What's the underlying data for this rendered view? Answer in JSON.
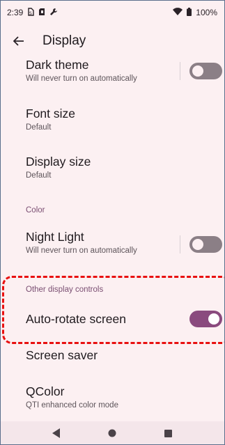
{
  "status_bar": {
    "time": "2:39",
    "battery": "100%",
    "icons": [
      "sim-icon",
      "sd-card-icon",
      "wrench-icon",
      "wifi-icon",
      "battery-icon"
    ]
  },
  "app_bar": {
    "title": "Display",
    "back_icon": "arrow-back-icon"
  },
  "settings": {
    "dark_theme": {
      "label": "Dark theme",
      "summary": "Will never turn on automatically",
      "enabled": false
    },
    "font_size": {
      "label": "Font size",
      "summary": "Default"
    },
    "display_size": {
      "label": "Display size",
      "summary": "Default"
    },
    "color_section": "Color",
    "night_light": {
      "label": "Night Light",
      "summary": "Will never turn on automatically",
      "enabled": false
    },
    "other_section": "Other display controls",
    "auto_rotate": {
      "label": "Auto-rotate screen",
      "enabled": true
    },
    "screen_saver": {
      "label": "Screen saver"
    },
    "qcolor": {
      "label": "QColor",
      "summary": "QTI enhanced color mode"
    }
  },
  "nav_bar": {
    "buttons": [
      "back-triangle-icon",
      "home-circle-icon",
      "recents-square-icon"
    ]
  },
  "colors": {
    "background": "#fcf0f2",
    "accent": "#8a4a7e",
    "highlight": "#e81010"
  }
}
